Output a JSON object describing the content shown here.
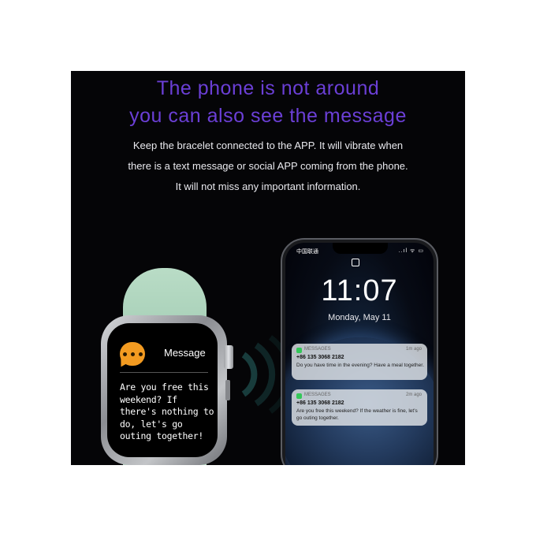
{
  "header": {
    "headline_line1": "The phone is not around",
    "headline_line2": "you can also see the message",
    "body_line1": "Keep the bracelet connected to the APP. It will vibrate when",
    "body_line2": "there is a text message or social APP coming from the phone.",
    "body_line3": "It will not miss any important information."
  },
  "watch": {
    "title": "Message",
    "message": "Are you free this weekend? If there's nothing to do, let's go outing together!",
    "icon": "chat-bubble-icon",
    "strap_color": "#b3d6c0",
    "accent_color": "#f39b21"
  },
  "phone": {
    "carrier": "中国联通",
    "status": "..ıl ᯤ ▭",
    "time": "11:07",
    "date": "Monday, May 11",
    "notifications": [
      {
        "app": "MESSAGES",
        "time": "1m ago",
        "sender": "+86 135 3068 2182",
        "text": "Do you have time in the evening? Have a meal together."
      },
      {
        "app": "MESSAGES",
        "time": "2m ago",
        "sender": "+86 135 3068 2182",
        "text": "Are you free this weekend? If the weather is fine, let's go outing together."
      }
    ]
  },
  "colors": {
    "headline": "#6b3fd6",
    "background": "#050507"
  }
}
